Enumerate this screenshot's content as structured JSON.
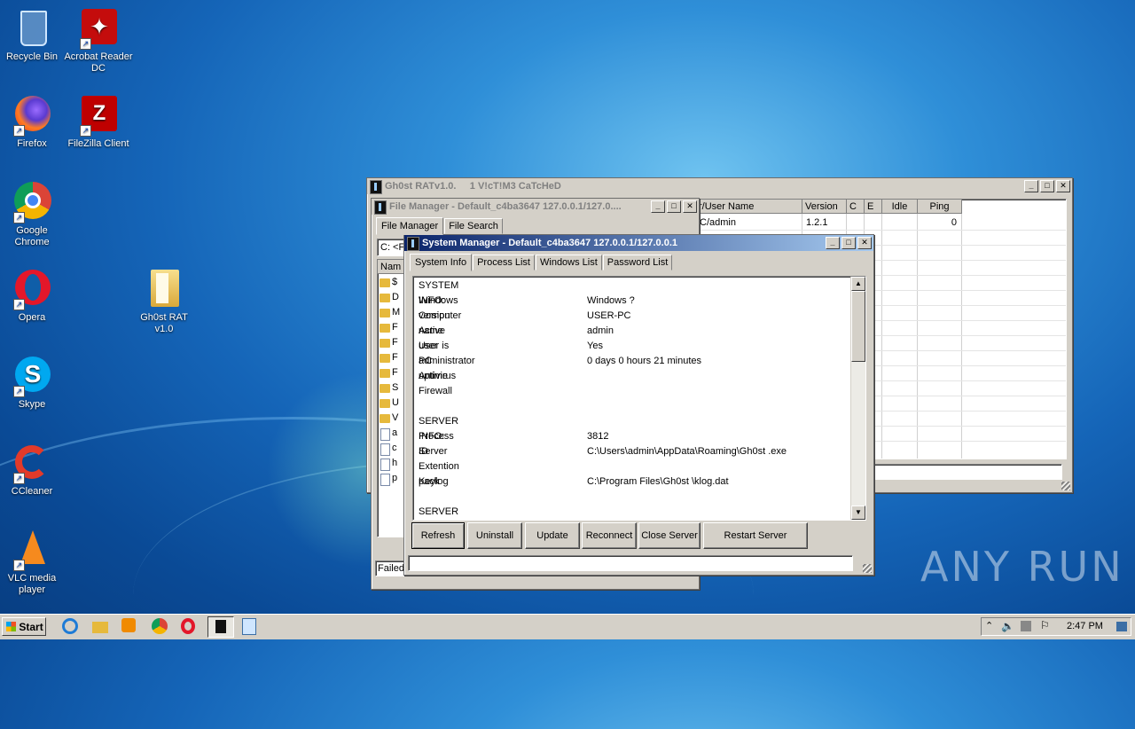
{
  "desktop": {
    "icons": [
      {
        "label": "Recycle Bin",
        "icon": "recycle-bin-icon"
      },
      {
        "label": "Acrobat Reader DC",
        "icon": "acrobat-icon"
      },
      {
        "label": "Firefox",
        "icon": "firefox-icon"
      },
      {
        "label": "FileZilla Client",
        "icon": "filezilla-icon"
      },
      {
        "label": "Google Chrome",
        "icon": "chrome-icon"
      },
      {
        "label": "Opera",
        "icon": "opera-icon"
      },
      {
        "label": "Gh0st RAT v1.0",
        "icon": "folder-icon"
      },
      {
        "label": "Skype",
        "icon": "skype-icon"
      },
      {
        "label": "CCleaner",
        "icon": "ccleaner-icon"
      },
      {
        "label": "VLC media player",
        "icon": "vlc-icon"
      }
    ]
  },
  "main_window": {
    "title": "Gh0st RATv1.0.     1 V!cT!M3 CaTcHeD",
    "columns": [
      "r/User Name",
      "Version",
      "C",
      "E",
      "Idle",
      "Ping"
    ],
    "rows": [
      [
        "C/admin",
        "1.2.1",
        "",
        "",
        "",
        "0"
      ]
    ]
  },
  "file_manager": {
    "title": "File Manager - Default_c4ba3647 127.0.0.1/127.0....",
    "tabs": [
      "File Manager",
      "File Search"
    ],
    "path": "C: <F",
    "column": "Nam",
    "items": [
      {
        "l": "$",
        "t": "folder"
      },
      {
        "l": "D",
        "t": "folder"
      },
      {
        "l": "M",
        "t": "folder"
      },
      {
        "l": "F",
        "t": "folder"
      },
      {
        "l": "F",
        "t": "folder"
      },
      {
        "l": "F",
        "t": "folder"
      },
      {
        "l": "F",
        "t": "folder"
      },
      {
        "l": "S",
        "t": "folder"
      },
      {
        "l": "U",
        "t": "folder"
      },
      {
        "l": "V",
        "t": "folder"
      },
      {
        "l": "a",
        "t": "file"
      },
      {
        "l": "c",
        "t": "file"
      },
      {
        "l": "h",
        "t": "file"
      },
      {
        "l": "p",
        "t": "file"
      }
    ],
    "status": "Failed"
  },
  "system_manager": {
    "title": "System Manager - Default_c4ba3647 127.0.0.1/127.0.0.1",
    "tabs": [
      "System Info",
      "Process List",
      "Windows List",
      "Password List"
    ],
    "info": [
      {
        "k": "SYSTEM INFO:",
        "v": ""
      },
      {
        "k": "Windows version",
        "v": "Windows ?"
      },
      {
        "k": "Computer name",
        "v": "USER-PC"
      },
      {
        "k": "Active user",
        "v": "admin"
      },
      {
        "k": "User is administrator",
        "v": "Yes"
      },
      {
        "k": "PC uptime",
        "v": "0 days 0 hours 21 minutes"
      },
      {
        "k": "Antivirus",
        "v": ""
      },
      {
        "k": "Firewall",
        "v": ""
      },
      {
        "k": "",
        "v": ""
      },
      {
        "k": "SERVER INFO:",
        "v": ""
      },
      {
        "k": "Process ID",
        "v": "3812"
      },
      {
        "k": "Server",
        "v": "C:\\Users\\admin\\AppData\\Roaming\\Gh0st .exe"
      },
      {
        "k": "Extention pack",
        "v": ""
      },
      {
        "k": "Keylog",
        "v": "C:\\Program Files\\Gh0st  \\klog.dat"
      },
      {
        "k": "",
        "v": ""
      },
      {
        "k": "SERVER SETTINGS:",
        "v": ""
      }
    ],
    "buttons": [
      "Refresh",
      "Uninstall",
      "Update",
      "Reconnect",
      "Close Server",
      "Restart Server"
    ]
  },
  "taskbar": {
    "start_label": "Start",
    "clock": "2:47 PM",
    "pinned": [
      "ie-icon",
      "explorer-icon",
      "media-player-icon",
      "chrome-icon",
      "opera-icon",
      "gh0st-icon",
      "notepad-icon"
    ]
  },
  "watermark": "ANY RUN"
}
